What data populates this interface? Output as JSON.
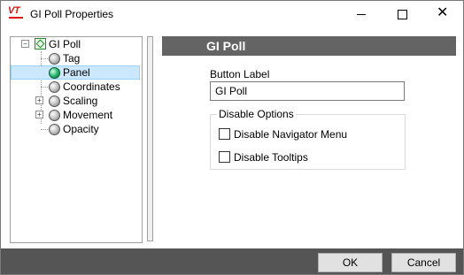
{
  "window": {
    "title": "GI Poll Properties",
    "app_icon": "vt-logo-icon",
    "controls": [
      "minimize-icon",
      "maximize-icon",
      "close-icon"
    ]
  },
  "tree": {
    "root": {
      "label": "GI Poll",
      "expanded": true,
      "icon": "object-icon"
    },
    "items": [
      {
        "label": "Tag",
        "expandable": false,
        "selected": false
      },
      {
        "label": "Panel",
        "expandable": false,
        "selected": true
      },
      {
        "label": "Coordinates",
        "expandable": false,
        "selected": false
      },
      {
        "label": "Scaling",
        "expandable": true,
        "selected": false
      },
      {
        "label": "Movement",
        "expandable": true,
        "selected": false
      },
      {
        "label": "Opacity",
        "expandable": false,
        "selected": false
      }
    ]
  },
  "panel": {
    "header": "GI Poll",
    "button_label_caption": "Button Label",
    "button_label_value": "GI Poll",
    "disable_group_title": "Disable Options",
    "checkbox_navigator": {
      "label": "Disable Navigator Menu",
      "checked": false
    },
    "checkbox_tooltips": {
      "label": "Disable Tooltips",
      "checked": false
    }
  },
  "footer": {
    "ok_label": "OK",
    "cancel_label": "Cancel"
  },
  "colors": {
    "header_bg": "#646464",
    "footer_bg": "#555555",
    "selection_bg": "#cce8ff",
    "selected_node": "#2bb673",
    "logo": "#dd1111"
  }
}
